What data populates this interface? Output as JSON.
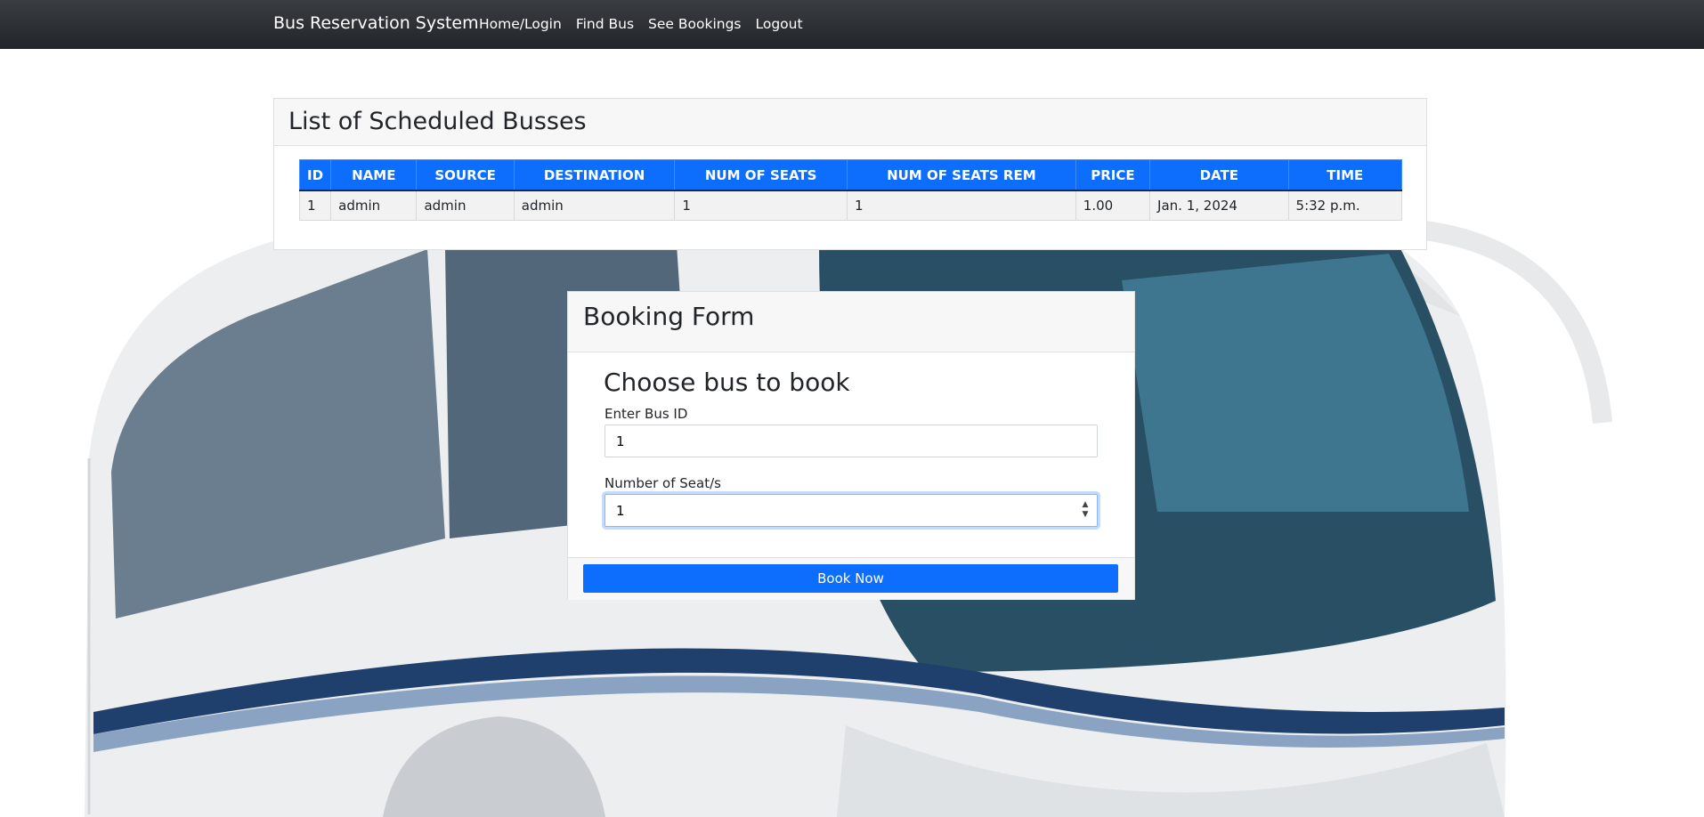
{
  "navbar": {
    "brand": "Bus Reservation System",
    "links": [
      "Home/Login",
      "Find Bus",
      "See Bookings",
      "Logout"
    ]
  },
  "bus_list": {
    "title": "List of Scheduled Busses",
    "columns": [
      "ID",
      "NAME",
      "SOURCE",
      "DESTINATION",
      "NUM OF SEATS",
      "NUM OF SEATS REM",
      "PRICE",
      "DATE",
      "TIME"
    ],
    "rows": [
      [
        "1",
        "admin",
        "admin",
        "admin",
        "1",
        "1",
        "1.00",
        "Jan. 1, 2024",
        "5:32 p.m."
      ]
    ]
  },
  "booking_form": {
    "title": "Booking Form",
    "subtitle": "Choose bus to book",
    "bus_id_label": "Enter Bus ID",
    "bus_id_value": "1",
    "seats_label": "Number of Seat/s",
    "seats_value": "1",
    "submit_label": "Book Now"
  },
  "colors": {
    "navbar": "#212529",
    "primary": "#0d6efd",
    "card_header": "#f7f7f7"
  },
  "icons": {
    "stepper": "stepper-arrows-icon",
    "background": "bus-photo"
  }
}
